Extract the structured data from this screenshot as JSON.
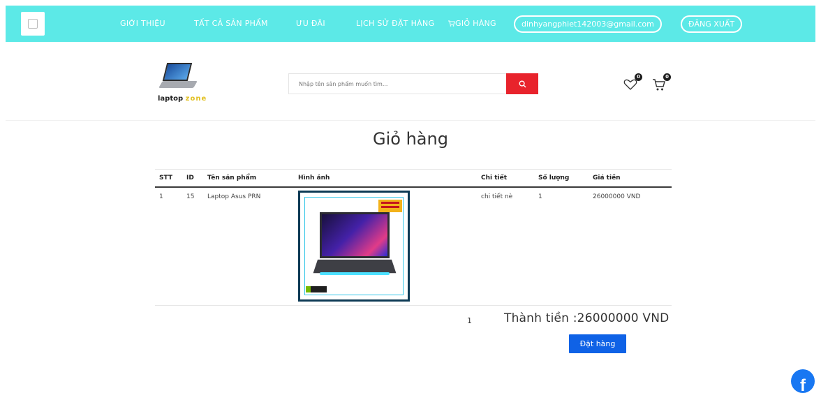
{
  "nav": {
    "items": [
      "GIỚI THIỆU",
      "TẤT CẢ SẢN PHẨM",
      "ƯU ĐÃI",
      "LỊCH SỬ ĐẶT HÀNG",
      "GIỎ HÀNG"
    ],
    "user_email": "dinhyangphiet142003@gmail.com",
    "logout_label": "ĐĂNG XUẤT",
    "background_color": "#5ce9e7"
  },
  "header": {
    "brand_name": "laptop",
    "brand_suffix": "zone",
    "search_placeholder": "Nhập tên sản phẩm muốn tìm...",
    "wishlist_count": "0",
    "cart_count": "0",
    "search_button_color": "#e8232c"
  },
  "cart": {
    "title": "Giỏ hàng",
    "columns": [
      "STT",
      "ID",
      "Tên sản phẩm",
      "Hình ảnh",
      "Chi tiết",
      "Số lượng",
      "Giá tiền"
    ],
    "rows": [
      {
        "stt": "1",
        "id": "15",
        "name": "Laptop Asus PRN",
        "detail": "chi tiết nè",
        "quantity": "1",
        "price": "26000000 VND"
      }
    ],
    "total_quantity": "1",
    "total_text": "Thành tiền :26000000 VND",
    "order_label": "Đặt hàng",
    "order_button_color": "#0f62e6"
  },
  "social": {
    "facebook_letter": "f",
    "facebook_color": "#1877f2"
  }
}
